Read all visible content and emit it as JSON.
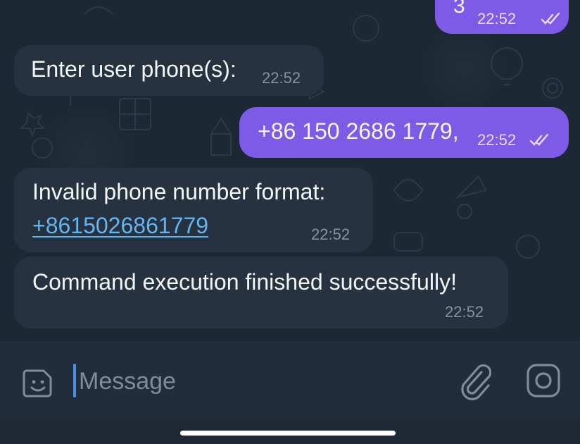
{
  "messages": [
    {
      "direction": "outgoing",
      "text": "3",
      "time": "22:52",
      "status": "read"
    },
    {
      "direction": "incoming",
      "text": "Enter user phone(s):",
      "time": "22:52"
    },
    {
      "direction": "outgoing",
      "text": "+86 150 2686 1779,",
      "time": "22:52",
      "status": "read"
    },
    {
      "direction": "incoming",
      "text": "Invalid phone number format:",
      "link": "+8615026861779",
      "time": "22:52"
    },
    {
      "direction": "incoming",
      "text": "Command execution finished successfully!",
      "time": "22:52"
    }
  ],
  "composer": {
    "placeholder": "Message",
    "icons": {
      "sticker": "sticker-icon",
      "attach": "paperclip-icon",
      "camera": "camera-icon"
    }
  },
  "colors": {
    "background": "#1c2833",
    "incoming_bubble": "#26323f",
    "outgoing_bubble": "#7e5be7",
    "link": "#64b4f0",
    "caret": "#4a90e2",
    "composer": "#212d3a"
  }
}
